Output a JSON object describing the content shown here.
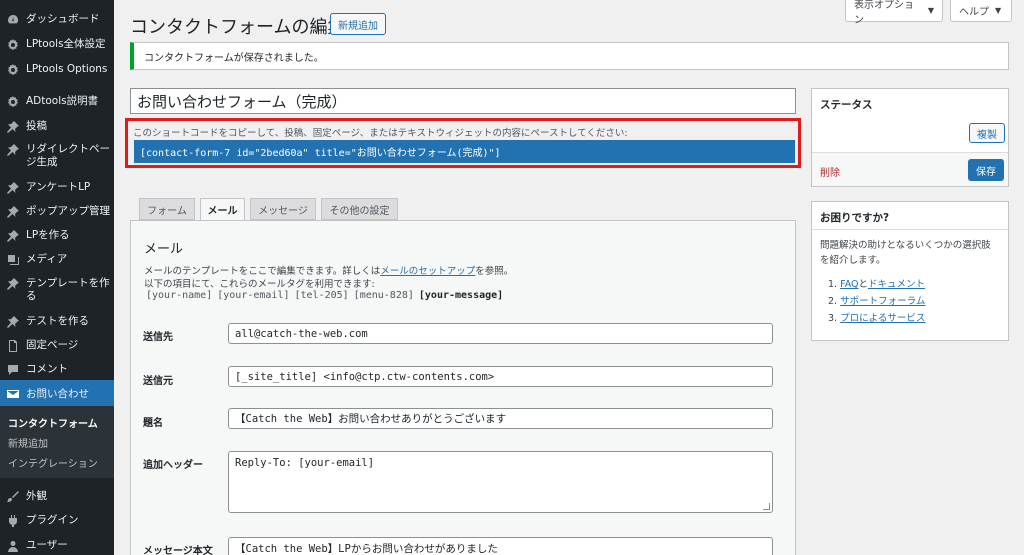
{
  "sidebar": {
    "items": [
      {
        "label": "ダッシュボード",
        "icon": "dashboard-icon"
      },
      {
        "label": "LPtools全体設定",
        "icon": "gear-icon"
      },
      {
        "label": "LPtools Options",
        "icon": "gear-icon"
      },
      {
        "label": "ADtools説明書",
        "icon": "gear-icon"
      },
      {
        "label": "投稿",
        "icon": "pin-icon"
      },
      {
        "label": "リダイレクトページ生成",
        "icon": "pin-icon"
      },
      {
        "label": "アンケートLP",
        "icon": "pin-icon"
      },
      {
        "label": "ポップアップ管理",
        "icon": "pin-icon"
      },
      {
        "label": "LPを作る",
        "icon": "pin-icon"
      },
      {
        "label": "メディア",
        "icon": "media-icon"
      },
      {
        "label": "テンプレートを作る",
        "icon": "pin-icon"
      },
      {
        "label": "テストを作る",
        "icon": "pin-icon"
      },
      {
        "label": "固定ページ",
        "icon": "page-icon"
      },
      {
        "label": "コメント",
        "icon": "comment-icon"
      },
      {
        "label": "お問い合わせ",
        "icon": "mail-icon"
      },
      {
        "label": "外観",
        "icon": "brush-icon"
      },
      {
        "label": "プラグイン",
        "icon": "plugin-icon"
      },
      {
        "label": "ユーザー",
        "icon": "user-icon"
      }
    ],
    "submenu": [
      "コンタクトフォーム",
      "新規追加",
      "インテグレーション"
    ]
  },
  "topbar": {
    "screen_options": "表示オプション",
    "help": "ヘルプ"
  },
  "header": {
    "title": "コンタクトフォームの編集",
    "add_new": "新規追加"
  },
  "notice": "コンタクトフォームが保存されました。",
  "form_title": "お問い合わせフォーム（完成）",
  "shortcode": {
    "label": "このショートコードをコピーして、投稿、固定ページ、またはテキストウィジェットの内容にペーストしてください:",
    "value": "[contact-form-7 id=\"2bed60a\" title=\"お問い合わせフォーム(完成)\"]"
  },
  "status": {
    "heading": "ステータス",
    "duplicate": "複製",
    "delete": "削除",
    "save": "保存"
  },
  "help_box": {
    "heading": "お困りですか?",
    "desc": "問題解決の助けとなるいくつかの選択肢を紹介します。",
    "link1_num": "1.",
    "link1a": "FAQ",
    "link1_and": "と",
    "link1b": "ドキュメント",
    "link2_num": "2.",
    "link2": "サポートフォーラム",
    "link3_num": "3.",
    "link3": "プロによるサービス"
  },
  "tabs": [
    "フォーム",
    "メール",
    "メッセージ",
    "その他の設定"
  ],
  "mail": {
    "heading": "メール",
    "desc1_pre": "メールのテンプレートをここで編集できます。詳しくは",
    "desc1_link": "メールのセットアップ",
    "desc1_post": "を参照。",
    "desc2": "以下の項目にて、これらのメールタグを利用できます:",
    "tags": [
      "[your-name]",
      "[your-email]",
      "[tel-205]",
      "[menu-828]"
    ],
    "tag_strong": "[your-message]",
    "fields": {
      "to_label": "送信先",
      "to_value": "all@catch-the-web.com",
      "from_label": "送信元",
      "from_value": "[_site_title] <info@ctp.ctw-contents.com>",
      "subject_label": "題名",
      "subject_value": "【Catch the Web】お問い合わせありがとうございます",
      "headers_label": "追加ヘッダー",
      "headers_value": "Reply-To: [your-email]",
      "body_label": "メッセージ本文",
      "body_value": "【Catch the Web】LPからお問い合わせがありました"
    }
  }
}
